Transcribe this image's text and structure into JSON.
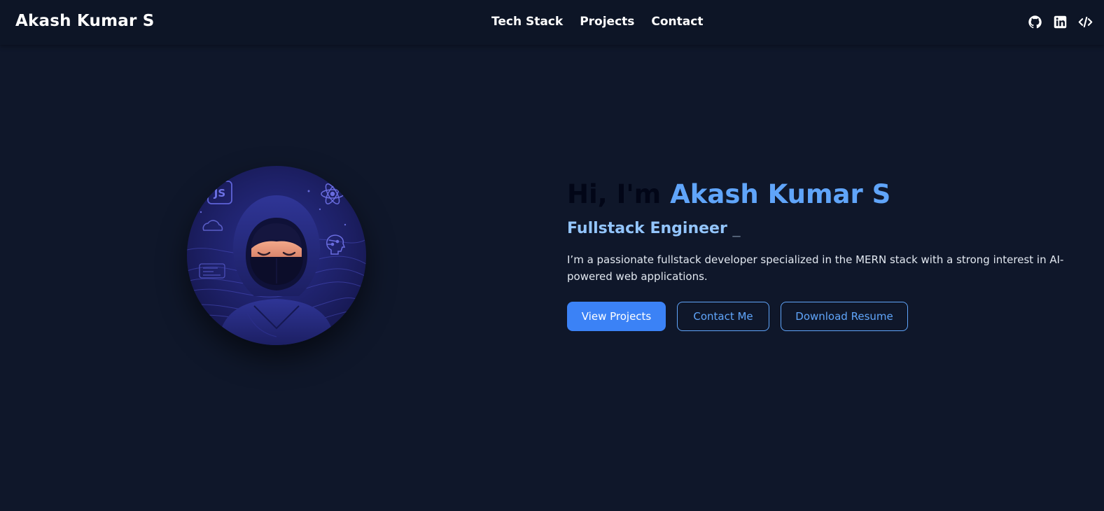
{
  "navbar": {
    "brand": "Akash Kumar S",
    "links": [
      "Tech Stack",
      "Projects",
      "Contact"
    ],
    "icons": [
      "github-icon",
      "linkedin-icon",
      "code-icon"
    ]
  },
  "hero": {
    "greeting_prefix": "Hi, I'm ",
    "name": "Akash Kumar S",
    "role": "Fullstack Engineer",
    "cursor": "_",
    "bio": "I’m a passionate fullstack developer specialized in the MERN stack with a strong interest in AI-powered web applications.",
    "buttons": {
      "view_projects": "View Projects",
      "contact_me": "Contact Me",
      "download_resume": "Download Resume"
    }
  },
  "avatar": {
    "badge_text": "JS",
    "icons": [
      "js-badge-icon",
      "react-atom-icon",
      "cloud-icon",
      "ai-brain-icon",
      "code-window-icon"
    ]
  },
  "colors": {
    "background": "#0f172a",
    "navbar": "#0d1526",
    "accent": "#3b82f6",
    "accent_light": "#60a5fa",
    "role": "#93c5fd"
  }
}
